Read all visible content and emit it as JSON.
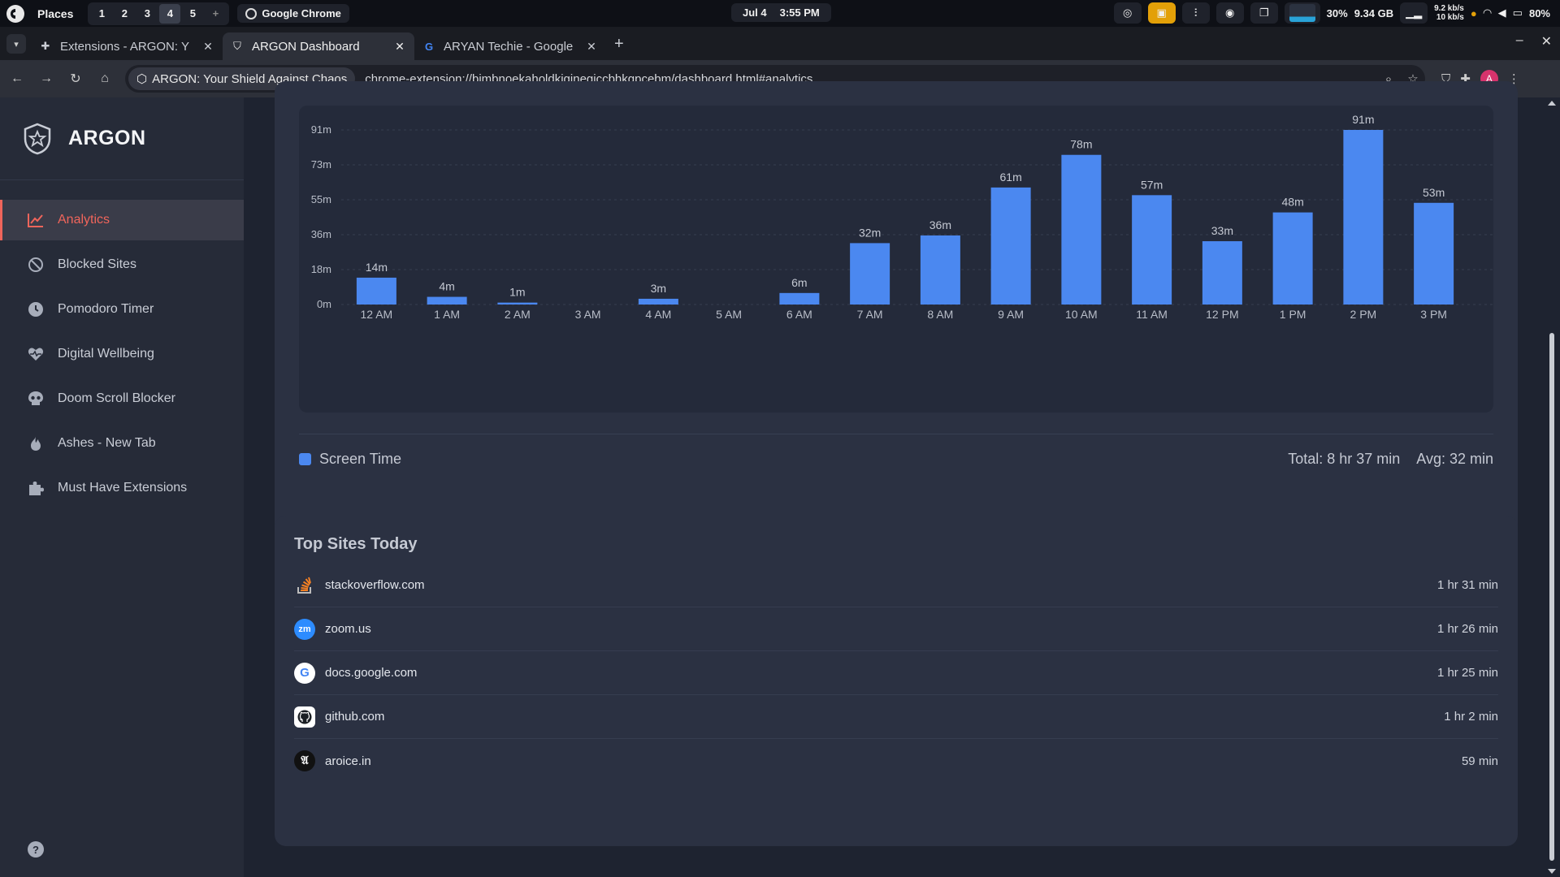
{
  "system": {
    "places": "Places",
    "workspaces": [
      "1",
      "2",
      "3",
      "4",
      "5"
    ],
    "active_workspace": "4",
    "workspace_add": "+",
    "app_name": "Google Chrome",
    "date": "Jul 4",
    "time": "3:55 PM",
    "cpu": "30%",
    "memory": "9.34 GB",
    "net_down": "9.2 kb/s",
    "net_up": "10 kb/s",
    "battery": "80%"
  },
  "browser": {
    "tabs": [
      {
        "title": "Extensions - ARGON: Y",
        "icon": "puzzle-icon",
        "active": false
      },
      {
        "title": "ARGON Dashboard",
        "icon": "shield-icon",
        "active": true
      },
      {
        "title": "ARYAN Techie - Google",
        "icon": "google-icon",
        "active": false
      }
    ],
    "site_chip": "ARGON: Your Shield Against Chaos",
    "url": "chrome-extension://bjmbnoekaholdkjgjnegjccbhkgpcebm/dashboard.html#analytics",
    "profile_initial": "A"
  },
  "sidebar": {
    "brand": "ARGON",
    "items": [
      {
        "label": "Analytics",
        "icon": "chart-line-icon",
        "active": true
      },
      {
        "label": "Blocked Sites",
        "icon": "block-icon",
        "active": false
      },
      {
        "label": "Pomodoro Timer",
        "icon": "clock-icon",
        "active": false
      },
      {
        "label": "Digital Wellbeing",
        "icon": "heart-pulse-icon",
        "active": false
      },
      {
        "label": "Doom Scroll Blocker",
        "icon": "skull-icon",
        "active": false
      },
      {
        "label": "Ashes - New Tab",
        "icon": "flame-icon",
        "active": false
      },
      {
        "label": "Must Have Extensions",
        "icon": "puzzle-icon",
        "active": false
      }
    ],
    "help": "?"
  },
  "chart_data": {
    "type": "bar",
    "categories": [
      "12 AM",
      "1 AM",
      "2 AM",
      "3 AM",
      "4 AM",
      "5 AM",
      "6 AM",
      "7 AM",
      "8 AM",
      "9 AM",
      "10 AM",
      "11 AM",
      "12 PM",
      "1 PM",
      "2 PM",
      "3 PM"
    ],
    "series": [
      {
        "name": "Screen Time",
        "values": [
          14,
          4,
          1,
          0,
          3,
          0,
          6,
          32,
          36,
          61,
          78,
          57,
          33,
          48,
          91,
          53
        ]
      }
    ],
    "value_labels": [
      "14m",
      "4m",
      "1m",
      "",
      "3m",
      "",
      "6m",
      "32m",
      "36m",
      "61m",
      "78m",
      "57m",
      "33m",
      "48m",
      "91m",
      "53m"
    ],
    "y_ticks": [
      "0m",
      "18m",
      "36m",
      "55m",
      "73m",
      "91m"
    ],
    "y_tick_values": [
      0,
      18.2,
      36.4,
      54.6,
      72.8,
      91
    ],
    "ylim": [
      0,
      91
    ],
    "color": "#4b88f0",
    "grid": true,
    "legend": "bottom-left"
  },
  "summary": {
    "legend_label": "Screen Time",
    "total": "Total: 8 hr 37 min",
    "avg": "Avg: 32 min"
  },
  "top_sites": {
    "title": "Top Sites Today",
    "rows": [
      {
        "domain": "stackoverflow.com",
        "time": "1 hr 31 min",
        "icon": "stackoverflow-icon"
      },
      {
        "domain": "zoom.us",
        "time": "1 hr 26 min",
        "icon": "zoom-icon"
      },
      {
        "domain": "docs.google.com",
        "time": "1 hr 25 min",
        "icon": "google-icon"
      },
      {
        "domain": "github.com",
        "time": "1 hr 2 min",
        "icon": "github-icon"
      },
      {
        "domain": "aroice.in",
        "time": "59 min",
        "icon": "aroice-icon"
      }
    ]
  }
}
